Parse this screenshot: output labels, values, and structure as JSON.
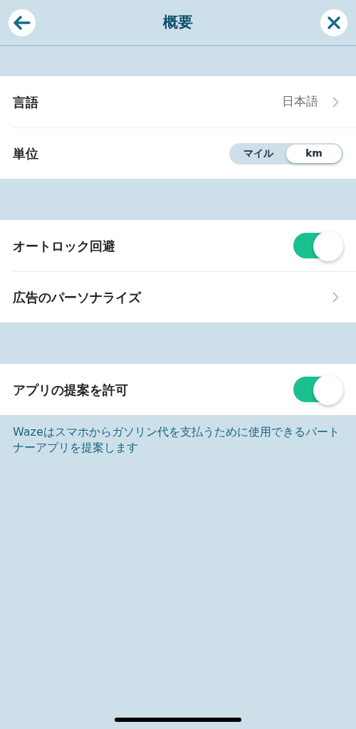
{
  "header": {
    "title": "概要"
  },
  "sections": [
    {
      "rows": [
        {
          "kind": "link",
          "label": "言語",
          "value": "日本語"
        },
        {
          "kind": "segmented",
          "label": "単位",
          "options": [
            {
              "label": "マイル",
              "selected": false
            },
            {
              "label": "km",
              "selected": true
            }
          ]
        }
      ]
    },
    {
      "rows": [
        {
          "kind": "toggle",
          "label": "オートロック回避",
          "on": true
        },
        {
          "kind": "link",
          "label": "広告のパーソナライズ"
        }
      ]
    },
    {
      "rows": [
        {
          "kind": "toggle",
          "label": "アプリの提案を許可",
          "on": true
        }
      ],
      "note": "Wazeはスマホからガソリン代を支払うために使用できるパートナーアプリを提案します"
    }
  ]
}
